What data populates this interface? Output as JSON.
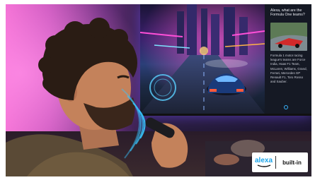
{
  "tv_panel": {
    "question": "Alexa, what are the Formula One teams?",
    "answer": "Formula 1 motor racing league's teams are Force India, Haas F1 Team, McLaren, Williams, Grand, Ferrari, Mercedes GP Renault F1, Toro Rosso and Sauber."
  },
  "badge": {
    "alexa_label": "alexa",
    "built_in_label": "built-in",
    "alexa_color": "#1aa3e8"
  },
  "colors": {
    "wall_pink": "#f06ad0",
    "screen_purple": "#3a1f6b",
    "voice_arc": "#37c6ff"
  }
}
